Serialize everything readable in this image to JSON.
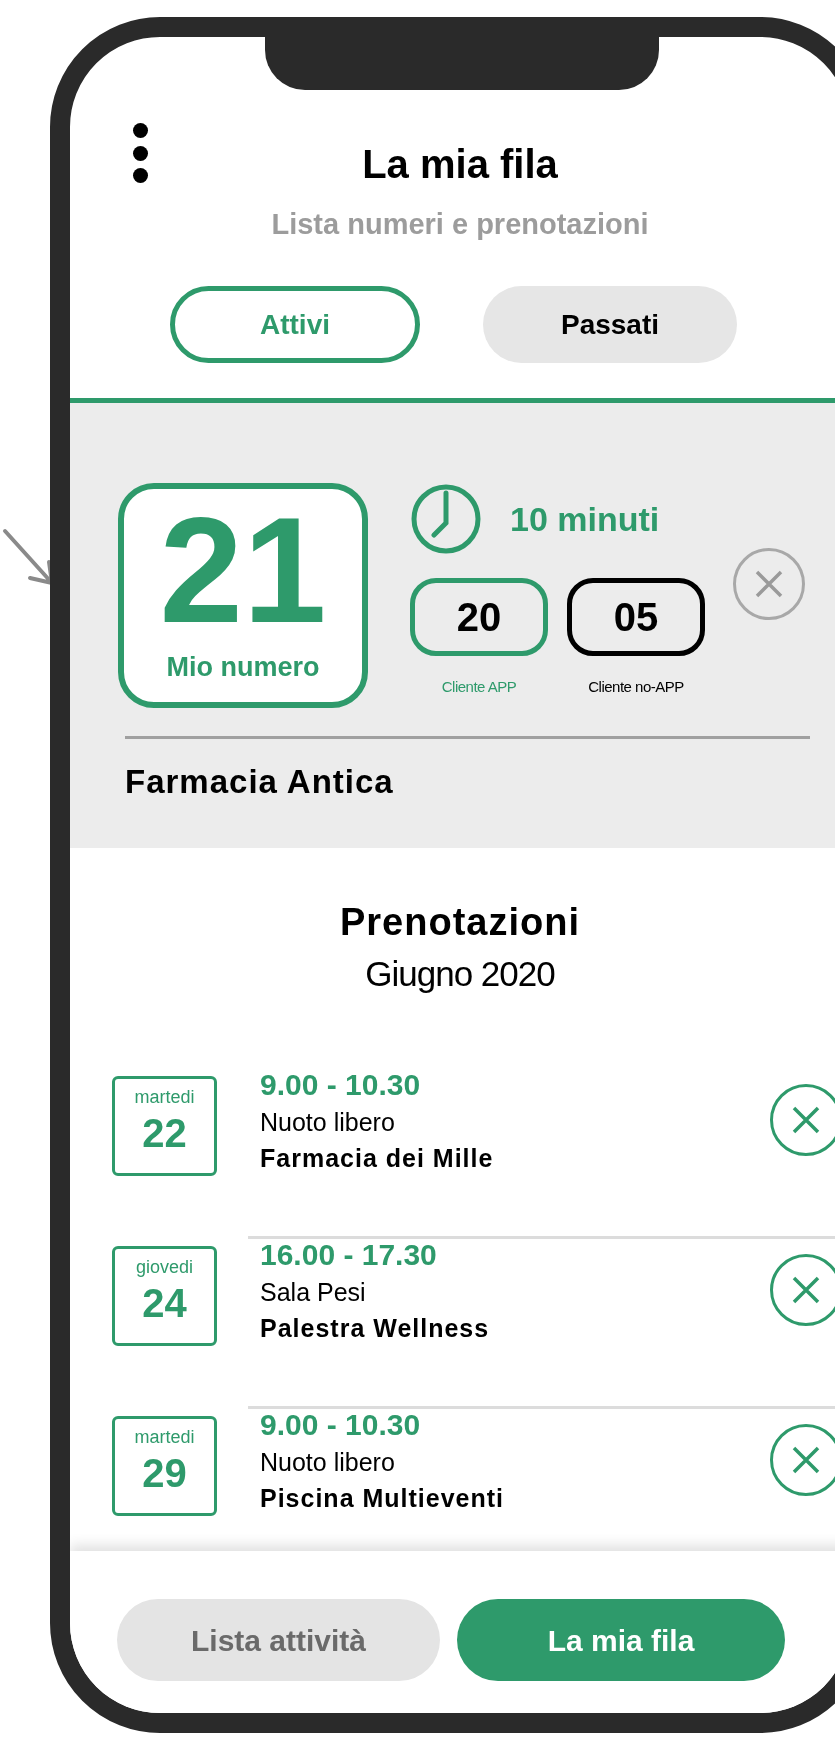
{
  "header": {
    "title": "La mia fila",
    "subtitle": "Lista numeri e prenotazioni"
  },
  "tabs": [
    {
      "label": "Attivi",
      "selected": true
    },
    {
      "label": "Passati",
      "selected": false
    }
  ],
  "queue_card": {
    "number": "21",
    "number_label": "Mio numero",
    "wait_time": "10 minuti",
    "counters": [
      {
        "kind": "app",
        "value": "20",
        "label": "Cliente APP"
      },
      {
        "kind": "no_app",
        "value": "05",
        "label": "Cliente no-APP"
      }
    ],
    "place": "Farmacia Antica"
  },
  "bookings": {
    "title": "Prenotazioni",
    "month": "Giugno 2020",
    "items": [
      {
        "weekday": "martedi",
        "day": "22",
        "time": "9.00 - 10.30",
        "activity": "Nuoto libero",
        "place": "Farmacia dei Mille"
      },
      {
        "weekday": "giovedi",
        "day": "24",
        "time": "16.00 - 17.30",
        "activity": "Sala Pesi",
        "place": "Palestra Wellness"
      },
      {
        "weekday": "martedi",
        "day": "29",
        "time": "9.00 - 10.30",
        "activity": "Nuoto libero",
        "place": "Piscina Multieventi"
      }
    ]
  },
  "bottom_nav": [
    {
      "label": "Lista attività",
      "selected": false
    },
    {
      "label": "La mia fila",
      "selected": true
    }
  ]
}
